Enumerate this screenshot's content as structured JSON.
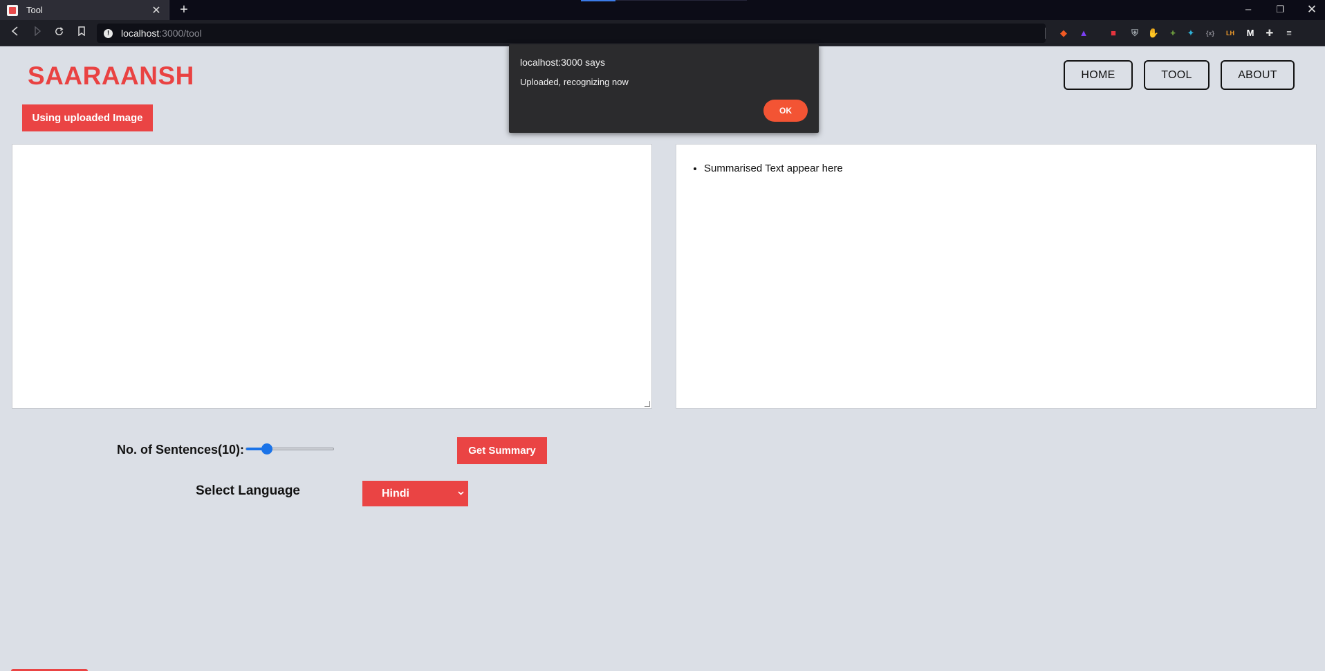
{
  "browser": {
    "tab_title": "Tool",
    "tab_close": "✕",
    "new_tab": "+",
    "url_host": "localhost",
    "url_path": ":3000/tool",
    "window_controls": {
      "minimize": "–",
      "maximize": "❐",
      "close": "✕"
    },
    "extensions": [
      {
        "name": "brave-shield-icon",
        "color": "#f15a24",
        "glyph": "◆"
      },
      {
        "name": "brave-rewards-icon",
        "color": "#7b3ff2",
        "glyph": "▲"
      },
      {
        "name": "extension-red-icon",
        "color": "#e4343e",
        "glyph": "■"
      },
      {
        "name": "shield-grey-icon",
        "color": "#9aa0a6",
        "glyph": "⛨"
      },
      {
        "name": "stop-sign-icon",
        "color": "#e0262b",
        "glyph": "✋"
      },
      {
        "name": "plus-green-icon",
        "color": "#7cb342",
        "glyph": "+"
      },
      {
        "name": "sparkle-icon",
        "color": "#2fb0d6",
        "glyph": "✦"
      },
      {
        "name": "braces-icon",
        "color": "#8d8d95",
        "glyph": "{x}"
      },
      {
        "name": "lighthouse-icon",
        "color": "#f19c2b",
        "glyph": "LH"
      },
      {
        "name": "m-extension-icon",
        "color": "#ffffff",
        "glyph": "M"
      },
      {
        "name": "puzzle-icon",
        "color": "#d8d8d8",
        "glyph": "✚"
      },
      {
        "name": "menu-icon",
        "color": "#d8d8d8",
        "glyph": "≡"
      }
    ]
  },
  "header": {
    "brand": "SAARAANSH",
    "nav": {
      "home": "HOME",
      "tool": "TOOL",
      "about": "ABOUT"
    }
  },
  "upload": {
    "label": "Using uploaded Image"
  },
  "input": {
    "value": ""
  },
  "output": {
    "items": [
      "Summarised Text appear here"
    ]
  },
  "controls": {
    "sentences_label": "No. of Sentences(10):",
    "slider": {
      "min": 1,
      "max": 50,
      "value": 10
    },
    "summary_button": "Get Summary",
    "language_label": "Select Language",
    "language_selected": "Hindi"
  },
  "dialog": {
    "title": "localhost:3000 says",
    "message": "Uploaded, recognizing now",
    "ok": "OK"
  },
  "colors": {
    "accent": "#ea4444",
    "page_bg": "#dbdfe6",
    "dialog_bg": "#2b2b2d",
    "dialog_ok": "#f35434",
    "slider": "#1a73e8"
  }
}
